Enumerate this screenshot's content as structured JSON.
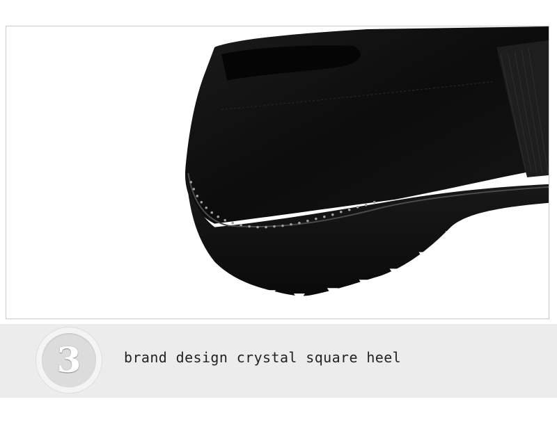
{
  "photo": {
    "subject": "shoe-heel-closeup",
    "colors": {
      "suede": "#0e0e0e",
      "sole": "#151515",
      "background": "#ffffff",
      "crystal": "#9a9a9a"
    }
  },
  "caption": {
    "step_number": "3",
    "text": "brand design crystal square heel",
    "band_color": "#ececec"
  }
}
